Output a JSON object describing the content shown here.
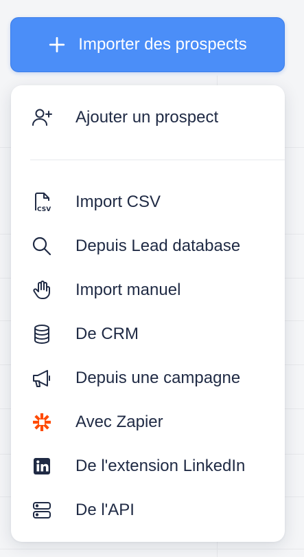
{
  "button": {
    "label": "Importer des prospects",
    "icon": "plus-icon"
  },
  "menu": {
    "top_item": {
      "label": "Ajouter un prospect",
      "icon": "user-plus-icon"
    },
    "items": [
      {
        "label": "Import CSV",
        "icon": "csv-file-icon"
      },
      {
        "label": "Depuis Lead database",
        "icon": "search-icon"
      },
      {
        "label": "Import manuel",
        "icon": "hand-icon"
      },
      {
        "label": "De CRM",
        "icon": "database-icon"
      },
      {
        "label": "Depuis une campagne",
        "icon": "megaphone-icon"
      },
      {
        "label": "Avec Zapier",
        "icon": "zapier-icon"
      },
      {
        "label": "De l'extension LinkedIn",
        "icon": "linkedin-icon"
      },
      {
        "label": "De l'API",
        "icon": "server-icon"
      }
    ]
  },
  "colors": {
    "button_bg": "#4b8ef8",
    "text": "#1f2a44",
    "zapier": "#ff4a00"
  }
}
